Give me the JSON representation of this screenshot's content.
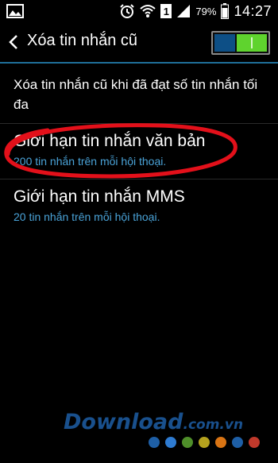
{
  "status_bar": {
    "battery_percent": "79%",
    "time": "14:27",
    "sim_badge": "1",
    "icons": [
      "image-icon",
      "alarm-icon",
      "wifi-icon",
      "sim-badge-icon",
      "signal-icon",
      "battery-icon"
    ]
  },
  "action_bar": {
    "back_icon": "chevron-left-icon",
    "title": "Xóa tin nhắn cũ",
    "switch_on": true
  },
  "list": {
    "items": [
      {
        "title": "Xóa tin nhắn cũ khi đã đạt số tin nhắn tối đa"
      },
      {
        "title": "Giới hạn tin nhắn văn bản",
        "summary": "200 tin nhắn trên mỗi hội thoại."
      },
      {
        "title": "Giới hạn tin nhắn MMS",
        "summary": "20 tin nhắn trên mỗi hội thoại."
      }
    ]
  },
  "colors": {
    "accent": "#4aa3d8",
    "switch_on": "#5fd32e",
    "annotation": "#e3101a",
    "divider": "#1f6f9a"
  },
  "watermark": {
    "brand": "Download",
    "domain": ".com.vn",
    "dot_colors": [
      "#1e5fa6",
      "#2e7bd1",
      "#4f8f2a",
      "#b5a21e",
      "#d97414",
      "#1e5fa6",
      "#c0392b"
    ]
  }
}
